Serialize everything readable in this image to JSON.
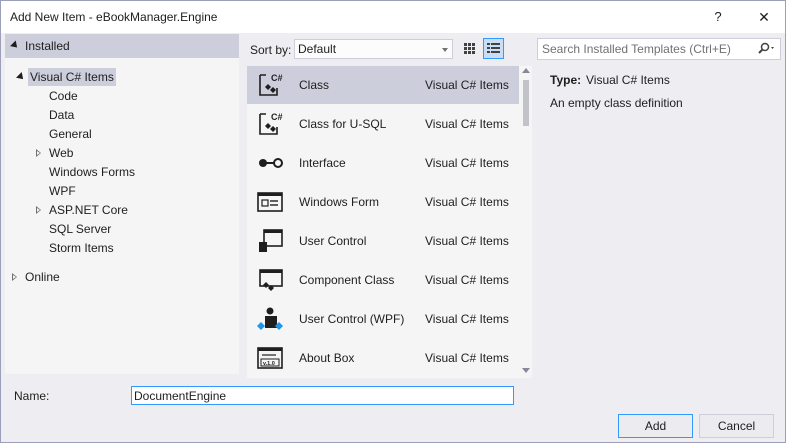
{
  "window": {
    "title": "Add New Item - eBookManager.Engine",
    "help_glyph": "?",
    "close_glyph": "✕"
  },
  "tree": {
    "installed_label": "Installed",
    "root_label": "Visual C# Items",
    "children": [
      {
        "label": "Code",
        "expandable": false
      },
      {
        "label": "Data",
        "expandable": false
      },
      {
        "label": "General",
        "expandable": false
      },
      {
        "label": "Web",
        "expandable": true
      },
      {
        "label": "Windows Forms",
        "expandable": false
      },
      {
        "label": "WPF",
        "expandable": false
      },
      {
        "label": "ASP.NET Core",
        "expandable": true
      },
      {
        "label": "SQL Server",
        "expandable": false
      },
      {
        "label": "Storm Items",
        "expandable": false
      }
    ],
    "online_label": "Online"
  },
  "sort": {
    "label": "Sort by:",
    "selected": "Default"
  },
  "view_buttons": {
    "small_icons": "small-icons-view-icon",
    "list": "list-view-icon"
  },
  "search": {
    "placeholder": "Search Installed Templates (Ctrl+E)",
    "icon": "search-icon"
  },
  "templates": [
    {
      "name": "Class",
      "type": "Visual C# Items",
      "icon": "class-icon",
      "selected": true
    },
    {
      "name": "Class for U-SQL",
      "type": "Visual C# Items",
      "icon": "usql-class-icon",
      "selected": false
    },
    {
      "name": "Interface",
      "type": "Visual C# Items",
      "icon": "interface-icon",
      "selected": false
    },
    {
      "name": "Windows Form",
      "type": "Visual C# Items",
      "icon": "windows-form-icon",
      "selected": false
    },
    {
      "name": "User Control",
      "type": "Visual C# Items",
      "icon": "user-control-icon",
      "selected": false
    },
    {
      "name": "Component Class",
      "type": "Visual C# Items",
      "icon": "component-class-icon",
      "selected": false
    },
    {
      "name": "User Control (WPF)",
      "type": "Visual C# Items",
      "icon": "wpf-user-control-icon",
      "selected": false
    },
    {
      "name": "About Box",
      "type": "Visual C# Items",
      "icon": "about-box-icon",
      "selected": false
    }
  ],
  "details": {
    "type_label": "Type:",
    "type_value": "Visual C# Items",
    "description": "An empty class definition"
  },
  "name_field": {
    "label": "Name:",
    "value": "DocumentEngine"
  },
  "buttons": {
    "add": "Add",
    "cancel": "Cancel"
  },
  "colors": {
    "selection": "#cccedb",
    "focus_border": "#3399ff",
    "icon_dark": "#1e1e1e",
    "icon_accent": "#1c97ea"
  }
}
